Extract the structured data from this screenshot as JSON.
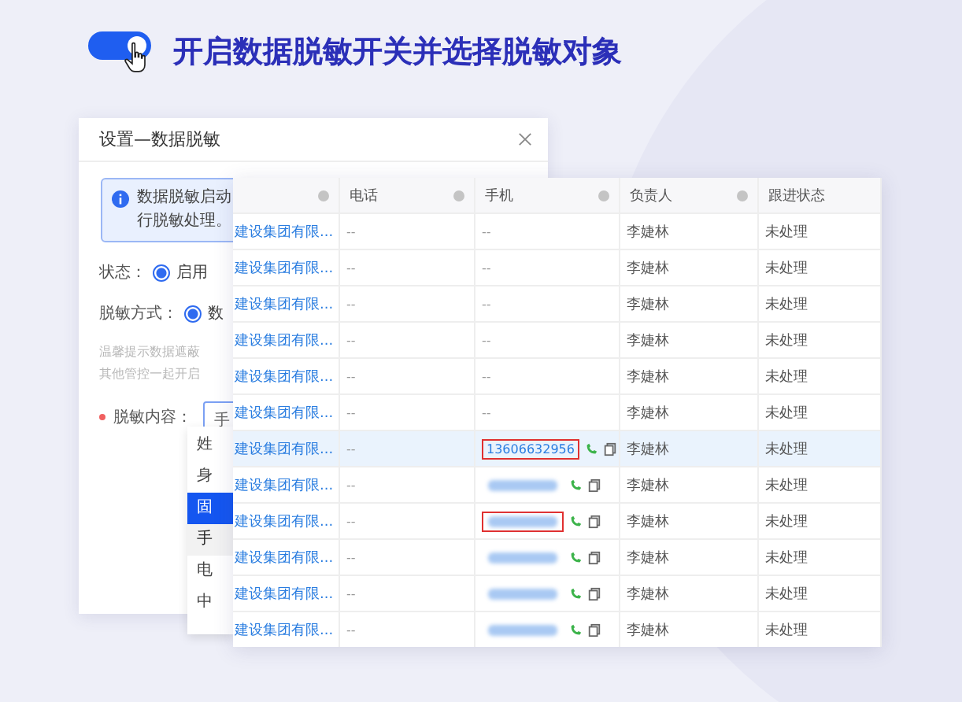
{
  "headline": {
    "switch_on": true,
    "text": "开启数据脱敏开关并选择脱敏对象"
  },
  "dialog": {
    "title": "设置—数据脱敏",
    "info_lines": [
      "数据脱敏启动",
      "行脱敏处理。"
    ],
    "status": {
      "label": "状态：",
      "options": [
        {
          "label": "启用",
          "selected": true
        }
      ]
    },
    "method": {
      "label": "脱敏方式：",
      "options": [
        {
          "label": "数",
          "selected": true
        }
      ]
    },
    "hints": [
      "温馨提示数据遮蔽",
      "其他管控一起开启"
    ],
    "content": {
      "label": "脱敏内容：",
      "required": true,
      "value": "手",
      "options": [
        {
          "label": "姓",
          "selected": false,
          "hovered": false
        },
        {
          "label": "身",
          "selected": false,
          "hovered": false
        },
        {
          "label": "固",
          "selected": false,
          "hovered": true
        },
        {
          "label": "手",
          "selected": true,
          "hovered": false
        },
        {
          "label": "电",
          "selected": false,
          "hovered": false
        },
        {
          "label": "中",
          "selected": false,
          "hovered": false
        }
      ]
    }
  },
  "table": {
    "columns": [
      {
        "menu": true
      },
      {
        "label": "电话",
        "menu": true
      },
      {
        "label": "手机",
        "menu": true
      },
      {
        "label": "负责人",
        "menu": true
      },
      {
        "label": "跟进状态",
        "menu": false
      }
    ],
    "rows": [
      {
        "company": "建设集团有限...",
        "phone": "--",
        "mobile": {
          "kind": "plain",
          "text": "--"
        },
        "owner": "李婕林",
        "status": "未处理",
        "selected": false
      },
      {
        "company": "建设集团有限...",
        "phone": "--",
        "mobile": {
          "kind": "plain",
          "text": "--"
        },
        "owner": "李婕林",
        "status": "未处理",
        "selected": false
      },
      {
        "company": "建设集团有限...",
        "phone": "--",
        "mobile": {
          "kind": "plain",
          "text": "--"
        },
        "owner": "李婕林",
        "status": "未处理",
        "selected": false
      },
      {
        "company": "建设集团有限...",
        "phone": "--",
        "mobile": {
          "kind": "plain",
          "text": "--"
        },
        "owner": "李婕林",
        "status": "未处理",
        "selected": false
      },
      {
        "company": "建设集团有限...",
        "phone": "--",
        "mobile": {
          "kind": "plain",
          "text": "--"
        },
        "owner": "李婕林",
        "status": "未处理",
        "selected": false
      },
      {
        "company": "建设集团有限...",
        "phone": "--",
        "mobile": {
          "kind": "plain",
          "text": "--"
        },
        "owner": "李婕林",
        "status": "未处理",
        "selected": false
      },
      {
        "company": "建设集团有限...",
        "phone": "--",
        "mobile": {
          "kind": "number",
          "text": "13606632956",
          "outlined": true
        },
        "owner": "李婕林",
        "status": "未处理",
        "selected": true
      },
      {
        "company": "建设集团有限...",
        "phone": "--",
        "mobile": {
          "kind": "blurred",
          "outlined": false
        },
        "owner": "李婕林",
        "status": "未处理",
        "selected": false
      },
      {
        "company": "建设集团有限...",
        "phone": "--",
        "mobile": {
          "kind": "blurred",
          "outlined": true
        },
        "owner": "李婕林",
        "status": "未处理",
        "selected": false
      },
      {
        "company": "建设集团有限...",
        "phone": "--",
        "mobile": {
          "kind": "blurred",
          "outlined": false
        },
        "owner": "李婕林",
        "status": "未处理",
        "selected": false
      },
      {
        "company": "建设集团有限...",
        "phone": "--",
        "mobile": {
          "kind": "blurred",
          "outlined": false
        },
        "owner": "李婕林",
        "status": "未处理",
        "selected": false
      },
      {
        "company": "建设集团有限...",
        "phone": "--",
        "mobile": {
          "kind": "blurred",
          "outlined": false
        },
        "owner": "李婕林",
        "status": "未处理",
        "selected": false
      }
    ]
  }
}
